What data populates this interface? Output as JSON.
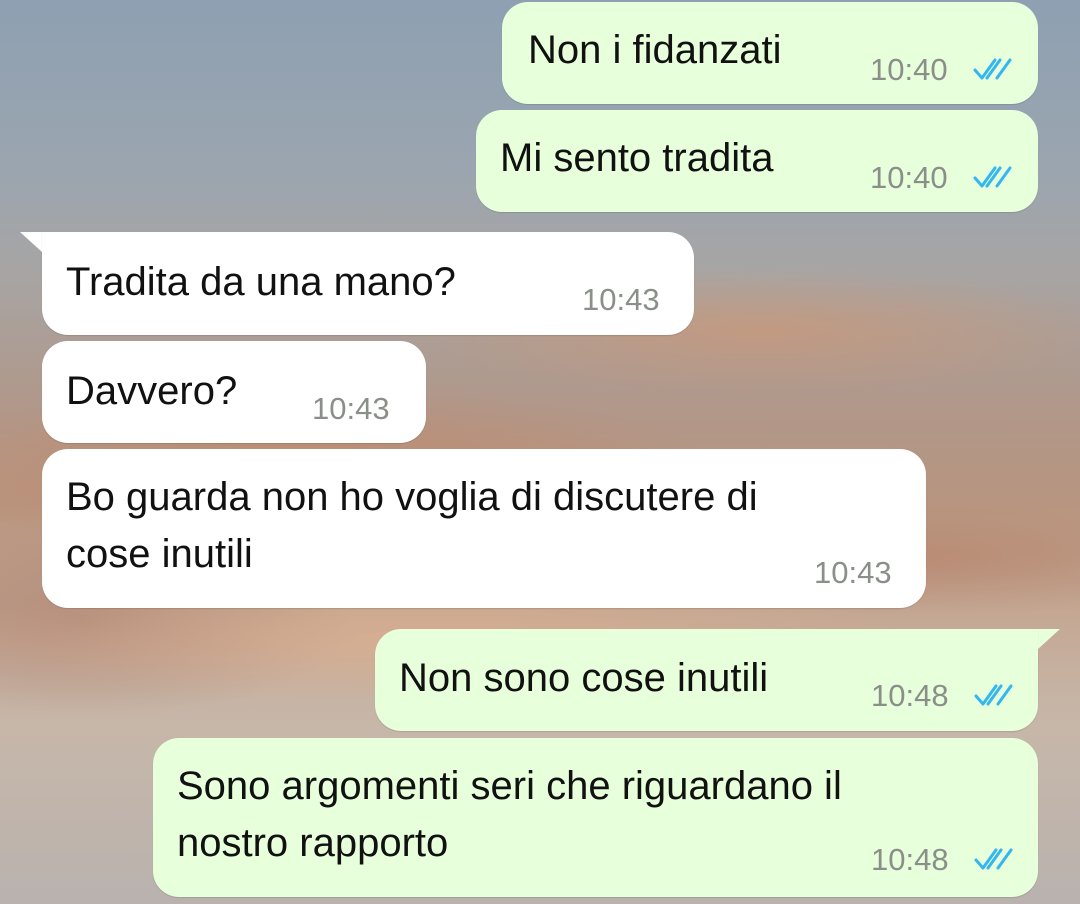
{
  "colors": {
    "outgoing_bubble": "#e7ffdb",
    "incoming_bubble": "#ffffff",
    "read_ticks": "#34b7f1",
    "timestamp": "#8a8f8a"
  },
  "messages": [
    {
      "direction": "outgoing",
      "text": "Non i fidanzati",
      "time": "10:40",
      "status_icon": "double-check-read-icon"
    },
    {
      "direction": "outgoing",
      "text": "Mi sento tradita",
      "time": "10:40",
      "status_icon": "double-check-read-icon"
    },
    {
      "direction": "incoming",
      "text": "Tradita da una mano?",
      "time": "10:43"
    },
    {
      "direction": "incoming",
      "text": "Davvero?",
      "time": "10:43"
    },
    {
      "direction": "incoming",
      "text": "Bo guarda non ho voglia di discutere di\ncose inutili",
      "time": "10:43"
    },
    {
      "direction": "outgoing",
      "text": "Non sono cose inutili",
      "time": "10:48",
      "status_icon": "double-check-read-icon"
    },
    {
      "direction": "outgoing",
      "text": "Sono argomenti seri che riguardano il\nnostro rapporto",
      "time": "10:48",
      "status_icon": "double-check-read-icon"
    }
  ]
}
